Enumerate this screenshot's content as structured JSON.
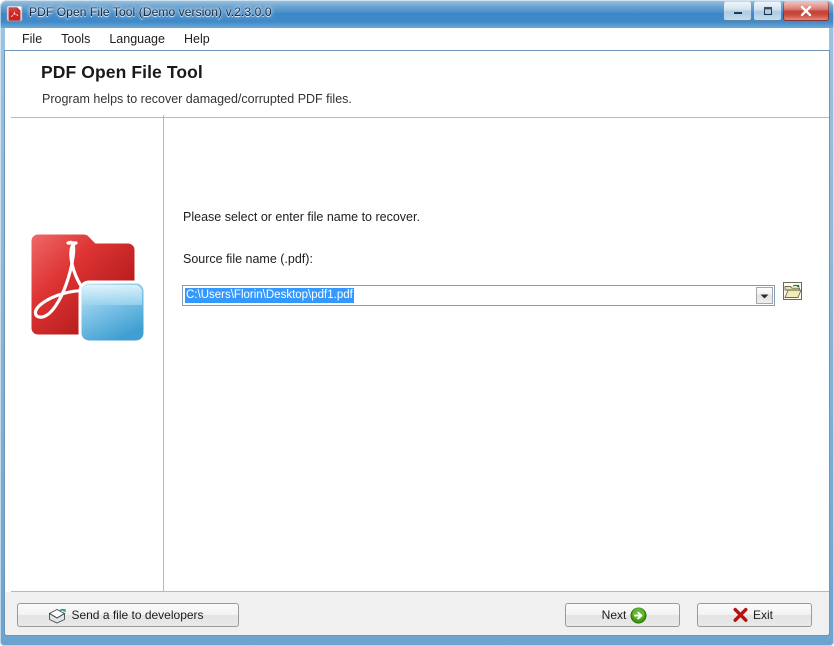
{
  "window": {
    "title": "PDF Open File Tool (Demo version) v.2.3.0.0",
    "icon": "pdf-app-icon",
    "controls": {
      "minimize": "minimize-icon",
      "maximize": "maximize-icon",
      "close": "close-icon"
    }
  },
  "menu": {
    "items": [
      {
        "label": "File"
      },
      {
        "label": "Tools"
      },
      {
        "label": "Language"
      },
      {
        "label": "Help"
      }
    ]
  },
  "header": {
    "title": "PDF Open File Tool",
    "subtitle": "Program helps to recover damaged/corrupted PDF files."
  },
  "sidebar": {
    "logo": "pdf-document-logo"
  },
  "main": {
    "instruction": "Please select or enter file name to recover.",
    "field_label": "Source file name (.pdf):",
    "source_file": {
      "value": "C:\\Users\\Florin\\Desktop\\pdf1.pdf",
      "placeholder": "",
      "selected": true,
      "dropdown_icon": "chevron-down-icon",
      "browse_icon": "open-folder-icon"
    }
  },
  "footer": {
    "send_button": {
      "label": "Send a file to developers",
      "icon": "envelope-send-icon"
    },
    "next_button": {
      "label": "Next",
      "icon": "green-arrow-right-icon"
    },
    "exit_button": {
      "label": "Exit",
      "icon": "red-x-icon"
    }
  },
  "colors": {
    "title_bar": "#3c87c8",
    "frame": "#8cb8da",
    "selection": "#3399ff",
    "accent_red": "#c41c1c",
    "accent_green": "#4caf16",
    "logo_red": "#d32222",
    "logo_blue": "#6ec0e8",
    "footer_bg": "#f0f0f0"
  }
}
